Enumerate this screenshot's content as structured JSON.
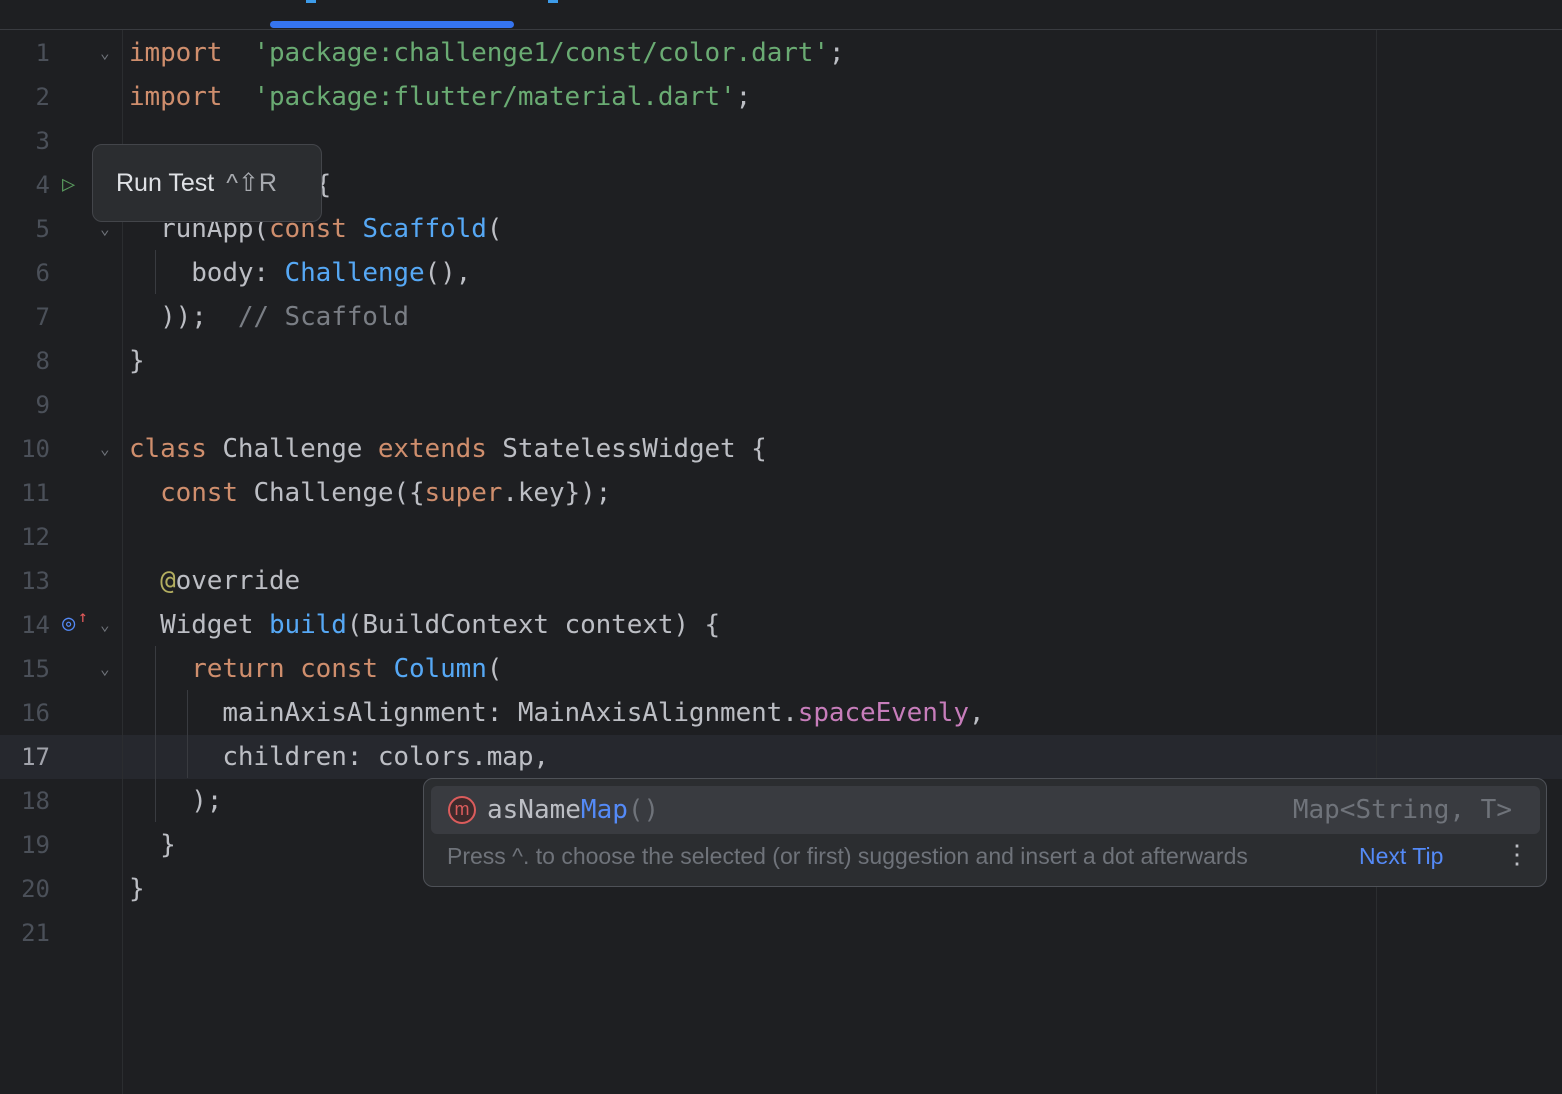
{
  "editor": {
    "current_line": 17,
    "lines": [
      {
        "n": "1",
        "fold": true,
        "tokens": [
          [
            "kw",
            "import"
          ],
          [
            "",
            "  "
          ],
          [
            "str",
            "'package:challenge1/const/color.dart'"
          ],
          [
            "",
            ";"
          ]
        ]
      },
      {
        "n": "2",
        "fold": false,
        "tokens": [
          [
            "kw",
            "import"
          ],
          [
            "",
            "  "
          ],
          [
            "str",
            "'package:flutter/material.dart'"
          ],
          [
            "",
            ";"
          ]
        ]
      },
      {
        "n": "3",
        "fold": false,
        "tokens": []
      },
      {
        "n": "4",
        "fold": false,
        "tokens": [
          [
            "",
            "            {"
          ]
        ]
      },
      {
        "n": "5",
        "fold": true,
        "tokens": [
          [
            "",
            "  runApp("
          ],
          [
            "kw",
            "const"
          ],
          [
            "",
            " "
          ],
          [
            "cls",
            "Scaffold"
          ],
          [
            "",
            "("
          ]
        ]
      },
      {
        "n": "6",
        "fold": false,
        "tokens": [
          [
            "",
            "    body: "
          ],
          [
            "cls",
            "Challenge"
          ],
          [
            "",
            "(),"
          ]
        ]
      },
      {
        "n": "7",
        "fold": false,
        "tokens": [
          [
            "",
            "  ));  "
          ],
          [
            "cm",
            "// Scaffold"
          ]
        ]
      },
      {
        "n": "8",
        "fold": false,
        "tokens": [
          [
            "",
            "}"
          ]
        ]
      },
      {
        "n": "9",
        "fold": false,
        "tokens": []
      },
      {
        "n": "10",
        "fold": true,
        "tokens": [
          [
            "kw",
            "class"
          ],
          [
            "",
            " Challenge "
          ],
          [
            "kw",
            "extends"
          ],
          [
            "",
            " StatelessWidget {"
          ]
        ]
      },
      {
        "n": "11",
        "fold": false,
        "tokens": [
          [
            "",
            "  "
          ],
          [
            "kw",
            "const"
          ],
          [
            "",
            " Challenge({"
          ],
          [
            "kw",
            "super"
          ],
          [
            "",
            ".key});"
          ]
        ]
      },
      {
        "n": "12",
        "fold": false,
        "tokens": []
      },
      {
        "n": "13",
        "fold": false,
        "tokens": [
          [
            "",
            "  "
          ],
          [
            "ann",
            "@"
          ],
          [
            "",
            "override"
          ]
        ]
      },
      {
        "n": "14",
        "fold": true,
        "tokens": [
          [
            "",
            "  Widget "
          ],
          [
            "cls",
            "build"
          ],
          [
            "",
            "(BuildContext context) {"
          ]
        ]
      },
      {
        "n": "15",
        "fold": true,
        "tokens": [
          [
            "",
            "    "
          ],
          [
            "kw",
            "return"
          ],
          [
            "",
            " "
          ],
          [
            "kw",
            "const"
          ],
          [
            "",
            " "
          ],
          [
            "cls",
            "Column"
          ],
          [
            "",
            "("
          ]
        ]
      },
      {
        "n": "16",
        "fold": false,
        "tokens": [
          [
            "",
            "      mainAxisAlignment: MainAxisAlignment."
          ],
          [
            "fld",
            "spaceEvenly"
          ],
          [
            "",
            ","
          ]
        ]
      },
      {
        "n": "17",
        "fold": false,
        "tokens": [
          [
            "",
            "      children: colors.map,"
          ]
        ]
      },
      {
        "n": "18",
        "fold": false,
        "tokens": [
          [
            "",
            "    );"
          ]
        ]
      },
      {
        "n": "19",
        "fold": false,
        "tokens": [
          [
            "",
            "  }"
          ]
        ]
      },
      {
        "n": "20",
        "fold": false,
        "tokens": [
          [
            "",
            "}"
          ]
        ]
      },
      {
        "n": "21",
        "fold": false,
        "tokens": []
      }
    ]
  },
  "tooltip": {
    "label": "Run Test",
    "shortcut": "^⇧R"
  },
  "gutter_icons": {
    "line4": "run-test-icon",
    "line14": "override-method-icon"
  },
  "completion": {
    "item_icon": "method-icon",
    "item_icon_letter": "m",
    "item_prefix": "asName",
    "item_match": "Map",
    "item_params": "()",
    "item_type": "Map<String, T>",
    "hint": "Press ^. to choose the selected (or first) suggestion and insert a dot afterwards",
    "next_tip": "Next Tip",
    "more_icon": "⋮"
  },
  "colors": {
    "accent": "#3574f0",
    "keyword": "#cf8e6d",
    "string": "#6aab73",
    "class": "#56a8f5"
  }
}
